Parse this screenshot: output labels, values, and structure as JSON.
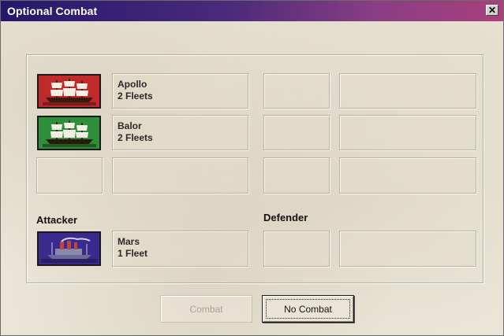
{
  "window": {
    "title": "Optional Combat"
  },
  "colors": {
    "fleet_apollo": "#c02a2a",
    "fleet_balor": "#2e8e3a",
    "fleet_mars": "#3b2a8e"
  },
  "fleets": [
    {
      "name": "Apollo",
      "count": "2 Fleets",
      "color": "red",
      "icon": "sailing-ship-icon"
    },
    {
      "name": "Balor",
      "count": "2 Fleets",
      "color": "green",
      "icon": "sailing-ship-icon"
    }
  ],
  "attacker": {
    "label": "Attacker",
    "name": "Mars",
    "count": "1 Fleet",
    "icon": "steamship-icon"
  },
  "defender": {
    "label": "Defender"
  },
  "buttons": {
    "combat": "Combat",
    "no_combat": "No Combat"
  }
}
